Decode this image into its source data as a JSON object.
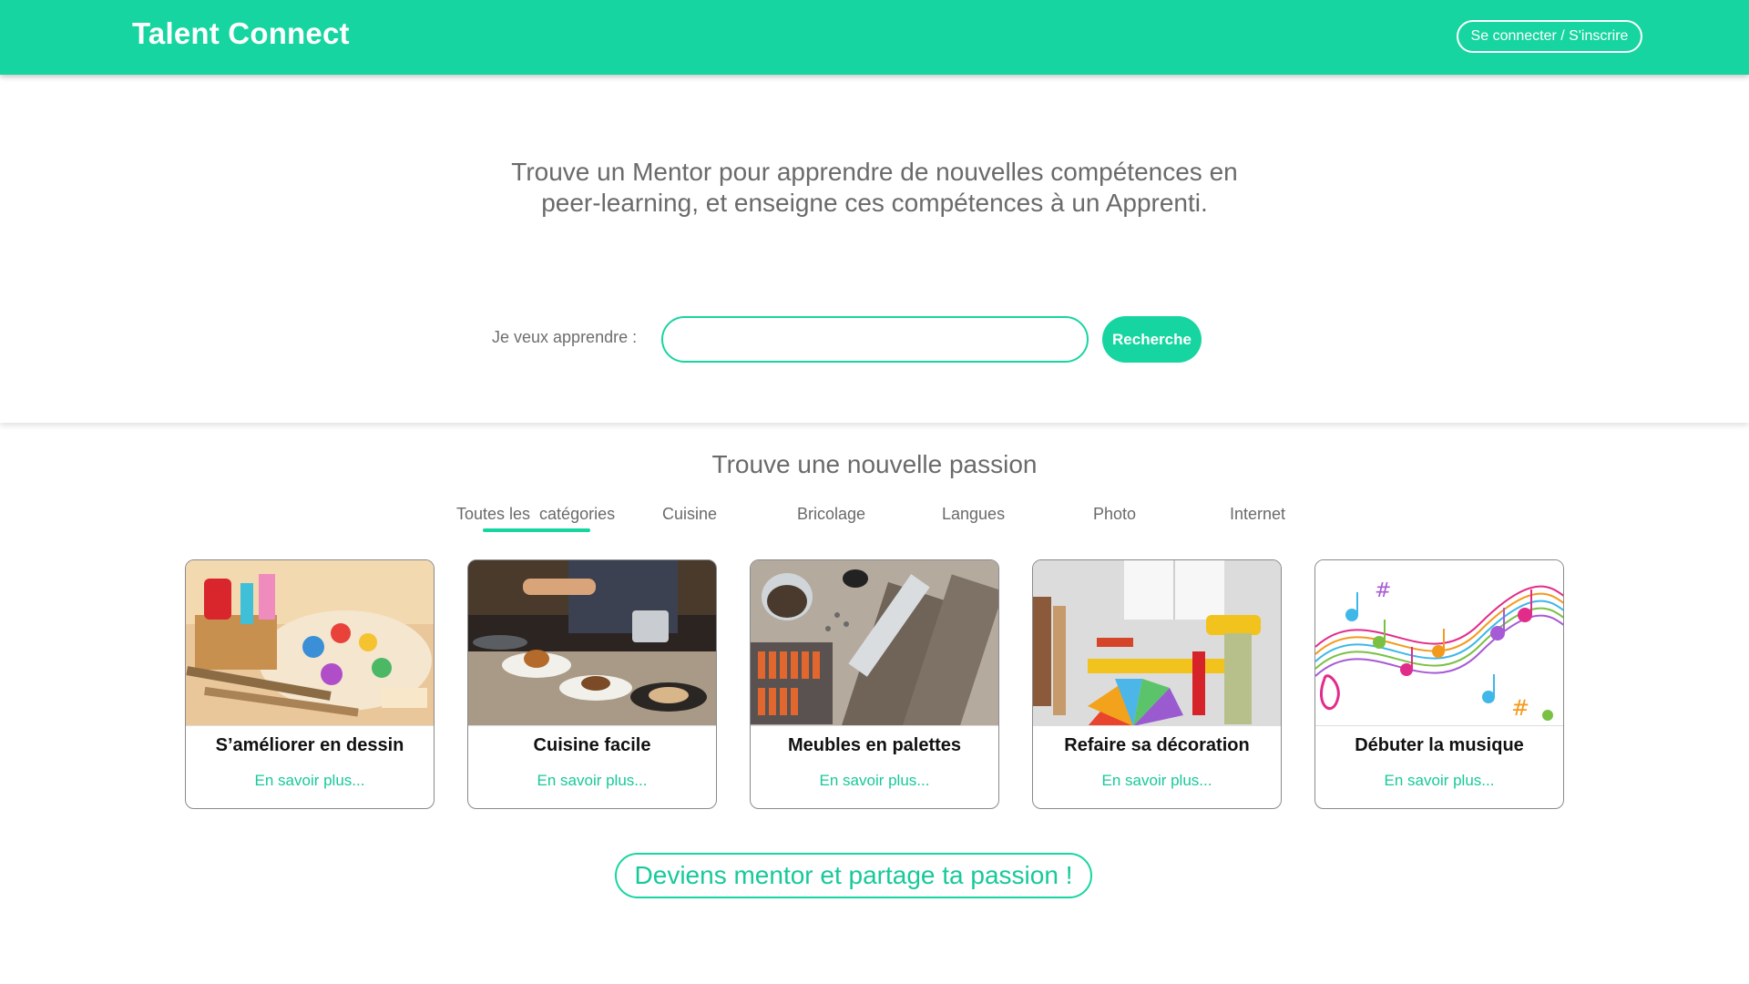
{
  "header": {
    "brand": "Talent Connect",
    "login_label": "Se connecter / S'inscrire",
    "accent_color": "#17d5a0"
  },
  "hero": {
    "tagline_line1": "Trouve un Mentor pour apprendre de nouvelles compétences en",
    "tagline_line2": "peer-learning, et enseigne ces compétences à un Apprenti.",
    "search_label": "Je veux apprendre :",
    "search_value": "",
    "search_button": "Recherche"
  },
  "passion": {
    "title": "Trouve une nouvelle passion",
    "tabs": [
      {
        "label": "Toutes les  catégories",
        "active": true
      },
      {
        "label": "Cuisine",
        "active": false
      },
      {
        "label": "Bricolage",
        "active": false
      },
      {
        "label": "Langues",
        "active": false
      },
      {
        "label": "Photo",
        "active": false
      },
      {
        "label": "Internet",
        "active": false
      }
    ],
    "cards": [
      {
        "title": "S’améliorer en dessin",
        "link": "En savoir plus...",
        "image": "art-supplies-image"
      },
      {
        "title": "Cuisine facile",
        "link": "En savoir plus...",
        "image": "chef-cooking-image"
      },
      {
        "title": "Meubles en palettes",
        "link": "En savoir plus...",
        "image": "diy-tools-image"
      },
      {
        "title": "Refaire sa décoration",
        "link": "En savoir plus...",
        "image": "decoration-tools-image"
      },
      {
        "title": "Débuter la musique",
        "link": "En savoir plus...",
        "image": "music-notes-image"
      }
    ]
  },
  "cta": {
    "label": "Deviens mentor et partage ta passion !"
  }
}
